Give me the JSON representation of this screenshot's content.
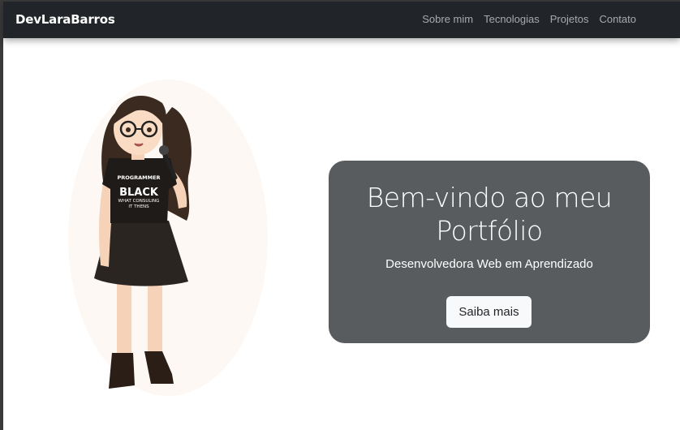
{
  "navbar": {
    "brand": "DevLaraBarros",
    "links": [
      {
        "label": "Sobre mim"
      },
      {
        "label": "Tecnologias"
      },
      {
        "label": "Projetos"
      },
      {
        "label": "Contato"
      }
    ]
  },
  "hero": {
    "illustration": {
      "shirt_text": [
        "PROGRAMMER",
        "BLACK",
        "WHAT CONSULING",
        "IT THENS"
      ]
    },
    "title_line1": "Bem-vindo ao meu",
    "title_line2": "Portfólio",
    "subtitle": "Desenvolvedora Web em Aprendizado",
    "button_label": "Saiba mais"
  },
  "colors": {
    "navbar_bg": "#212529",
    "card_bg": "#595c5f",
    "button_bg": "#f8f9fa",
    "link_muted": "rgba(255,255,255,0.60)"
  }
}
